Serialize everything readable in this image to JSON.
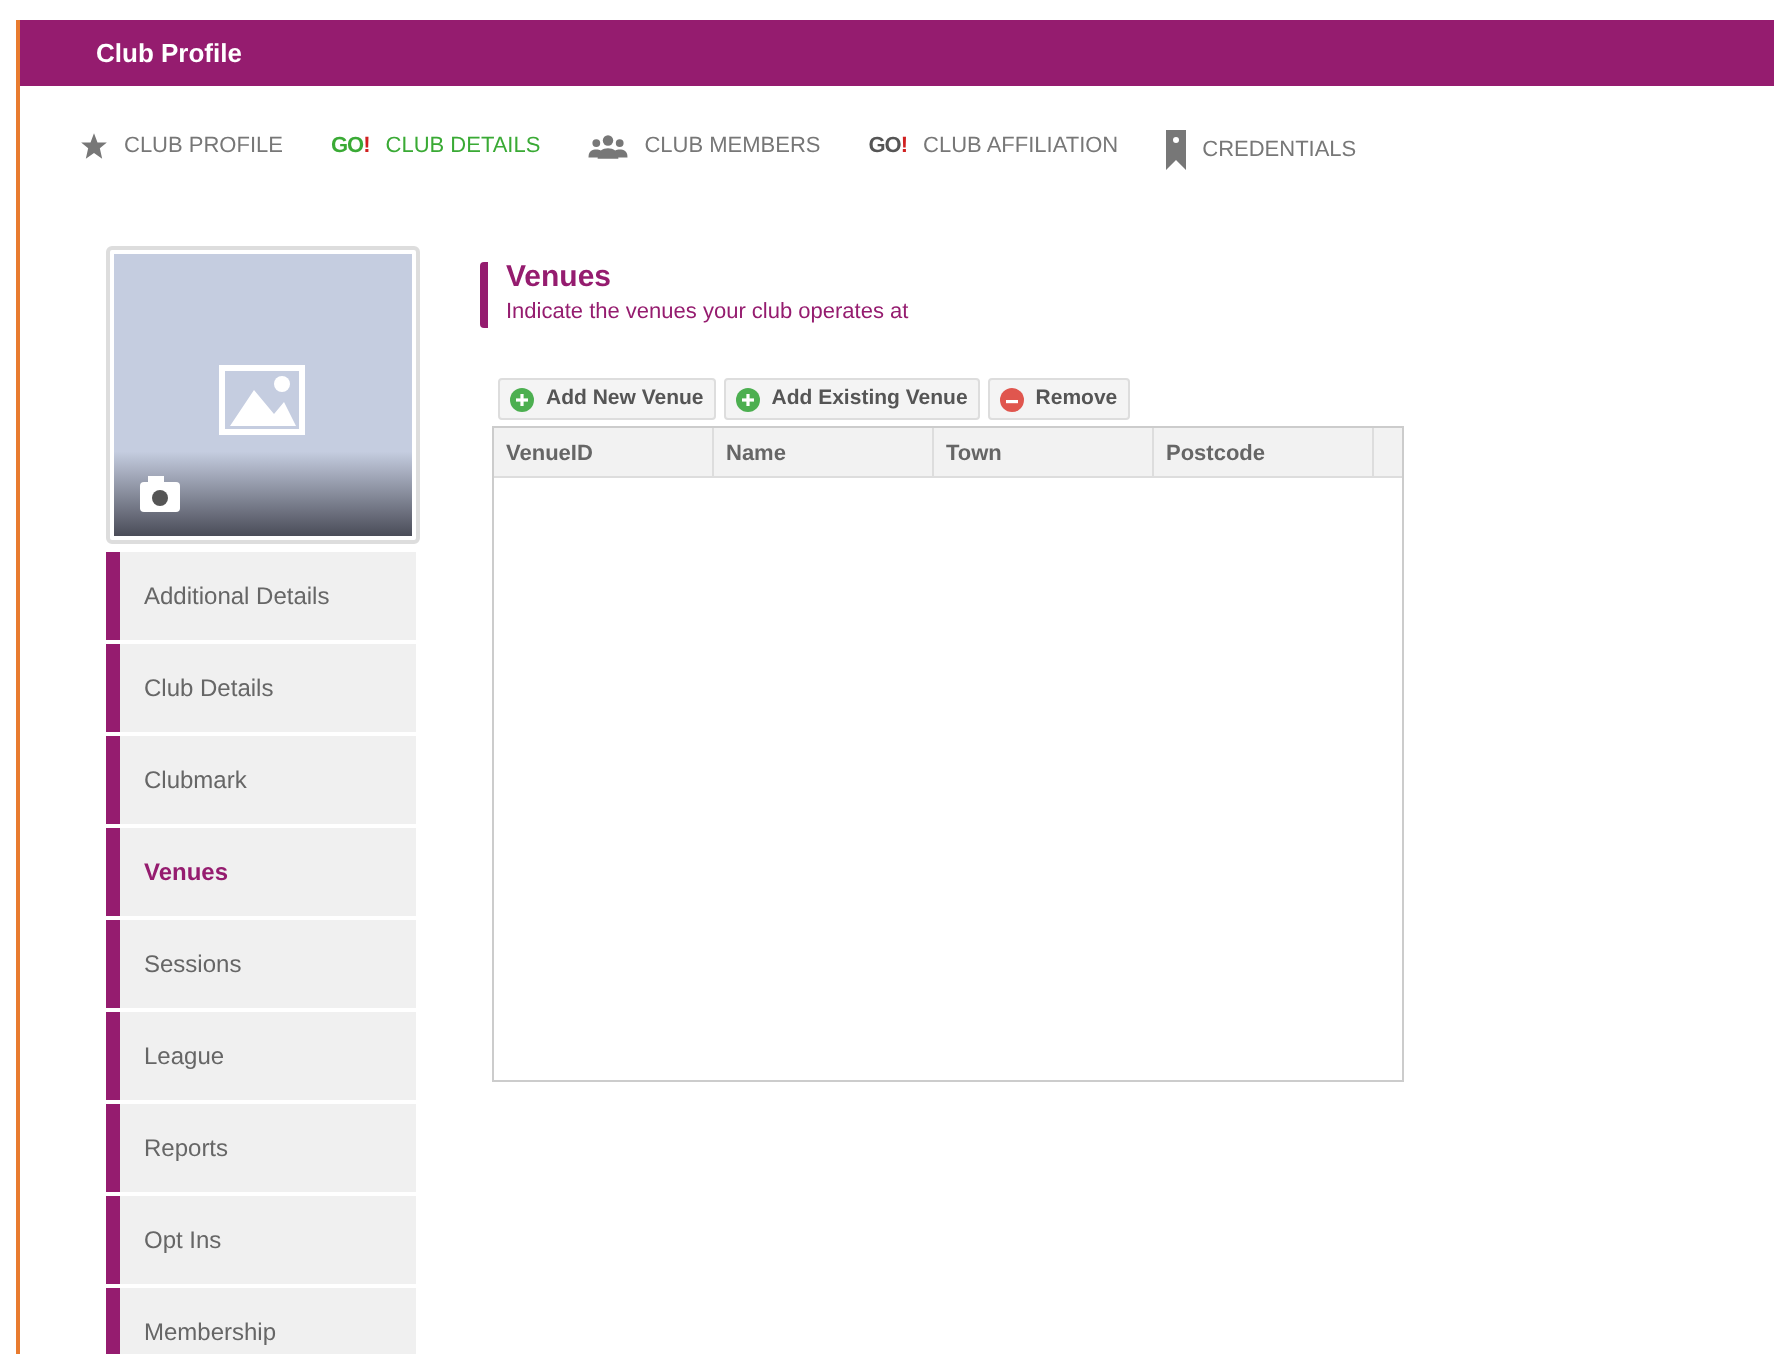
{
  "header": {
    "title": "Club Profile"
  },
  "tabs": [
    {
      "label": "CLUB PROFILE",
      "kind": "star",
      "selected": false
    },
    {
      "label": "CLUB DETAILS",
      "kind": "go",
      "go_text": "GO",
      "go_mark": "!",
      "selected": true
    },
    {
      "label": "CLUB MEMBERS",
      "kind": "members",
      "selected": false
    },
    {
      "label": "CLUB AFFILIATION",
      "kind": "go",
      "go_text": "GO",
      "go_mark": "!",
      "selected": false
    },
    {
      "label": "CREDENTIALS",
      "kind": "bookmark",
      "selected": false
    }
  ],
  "sidebar": {
    "items": [
      {
        "label": "Additional Details",
        "selected": false
      },
      {
        "label": "Club Details",
        "selected": false
      },
      {
        "label": "Clubmark",
        "selected": false
      },
      {
        "label": "Venues",
        "selected": true
      },
      {
        "label": "Sessions",
        "selected": false
      },
      {
        "label": "League",
        "selected": false
      },
      {
        "label": "Reports",
        "selected": false
      },
      {
        "label": "Opt Ins",
        "selected": false
      },
      {
        "label": "Membership",
        "selected": false
      }
    ]
  },
  "section": {
    "title": "Venues",
    "subtitle": "Indicate the venues your club operates at"
  },
  "toolbar": [
    {
      "label": "Add New Venue",
      "kind": "add"
    },
    {
      "label": "Add Existing Venue",
      "kind": "add"
    },
    {
      "label": "Remove",
      "kind": "remove"
    }
  ],
  "table": {
    "columns": [
      "VenueID",
      "Name",
      "Town",
      "Postcode"
    ]
  }
}
